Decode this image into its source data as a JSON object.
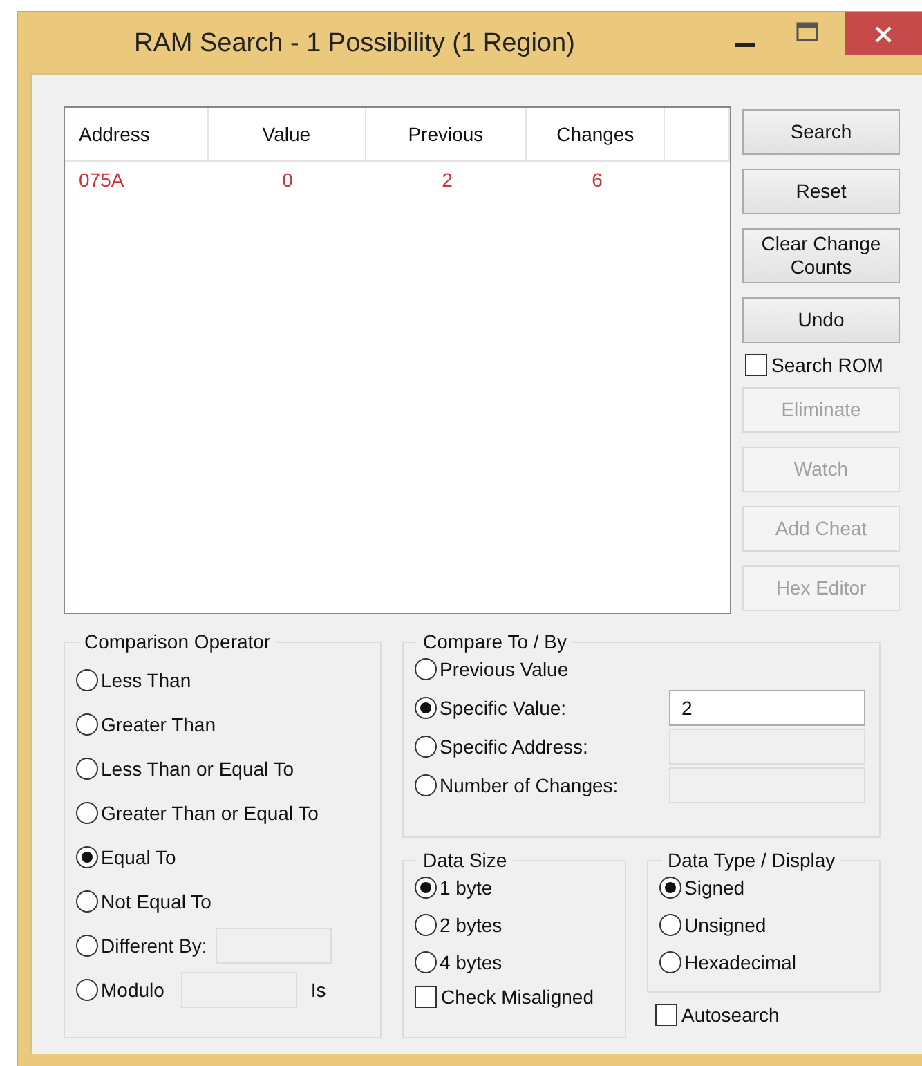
{
  "window": {
    "title": "RAM Search - 1 Possibility (1 Region)"
  },
  "results": {
    "columns": [
      "Address",
      "Value",
      "Previous",
      "Changes"
    ],
    "rows": [
      {
        "cells": [
          "075A",
          "0",
          "2",
          "6"
        ]
      }
    ]
  },
  "side_panel": [
    {
      "kind": "button",
      "label": "Search",
      "disabled": false
    },
    {
      "kind": "button",
      "label": "Reset",
      "disabled": false
    },
    {
      "kind": "button",
      "label": "Clear Change Counts",
      "disabled": false
    },
    {
      "kind": "button",
      "label": "Undo",
      "disabled": false
    },
    {
      "kind": "checkbox",
      "label": "Search ROM",
      "checked": false
    },
    {
      "kind": "button",
      "label": "Eliminate",
      "disabled": true
    },
    {
      "kind": "button",
      "label": "Watch",
      "disabled": true
    },
    {
      "kind": "button",
      "label": "Add Cheat",
      "disabled": true
    },
    {
      "kind": "button",
      "label": "Hex Editor",
      "disabled": true
    }
  ],
  "comparison_operator": {
    "title": "Comparison Operator",
    "options": [
      {
        "label": "Less Than",
        "selected": false
      },
      {
        "label": "Greater Than",
        "selected": false
      },
      {
        "label": "Less Than or Equal To",
        "selected": false
      },
      {
        "label": "Greater Than or Equal To",
        "selected": false
      },
      {
        "label": "Equal To",
        "selected": true
      },
      {
        "label": "Not Equal To",
        "selected": false
      },
      {
        "label": "Different By:",
        "selected": false,
        "field": {
          "disabled": true
        }
      },
      {
        "label": "Modulo",
        "selected": false,
        "field": {
          "disabled": true
        },
        "suffix": "Is"
      }
    ]
  },
  "compare_to": {
    "title": "Compare To / By",
    "options": [
      {
        "label": "Previous Value",
        "selected": false
      },
      {
        "label": "Specific Value:",
        "selected": true,
        "field": {
          "value": "2",
          "disabled": false
        }
      },
      {
        "label": "Specific Address:",
        "selected": false,
        "field": {
          "disabled": true
        }
      },
      {
        "label": "Number of Changes:",
        "selected": false,
        "field": {
          "disabled": true
        }
      }
    ]
  },
  "data_size": {
    "title": "Data Size",
    "options": [
      {
        "label": "1 byte",
        "selected": true
      },
      {
        "label": "2 bytes",
        "selected": false
      },
      {
        "label": "4 bytes",
        "selected": false
      }
    ],
    "check_misaligned": {
      "label": "Check Misaligned",
      "checked": false
    }
  },
  "data_type": {
    "title": "Data Type / Display",
    "options": [
      {
        "label": "Signed",
        "selected": true
      },
      {
        "label": "Unsigned",
        "selected": false
      },
      {
        "label": "Hexadecimal",
        "selected": false
      }
    ]
  },
  "autosearch": {
    "label": "Autosearch",
    "checked": false
  }
}
